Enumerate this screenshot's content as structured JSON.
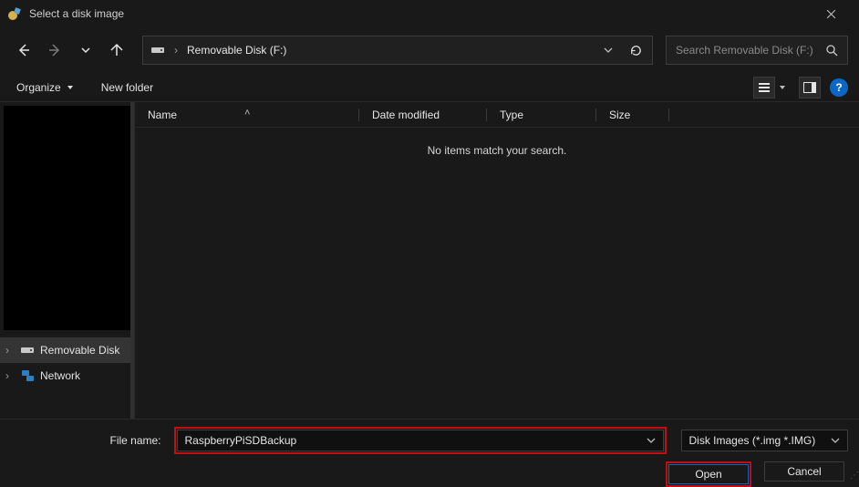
{
  "titlebar": {
    "title": "Select a disk image"
  },
  "path": {
    "location": "Removable Disk (F:)"
  },
  "search": {
    "placeholder": "Search Removable Disk (F:)"
  },
  "toolbar": {
    "organize": "Organize",
    "newfolder": "New folder"
  },
  "columns": {
    "name": "Name",
    "date": "Date modified",
    "type": "Type",
    "size": "Size"
  },
  "list": {
    "empty": "No items match your search."
  },
  "sidebar": {
    "items": [
      {
        "label": "Removable Disk"
      },
      {
        "label": "Network"
      }
    ]
  },
  "bottom": {
    "filename_label": "File name:",
    "filename_value": "RaspberryPiSDBackup",
    "filetype": "Disk Images (*.img *.IMG)",
    "open": "Open",
    "cancel": "Cancel"
  }
}
